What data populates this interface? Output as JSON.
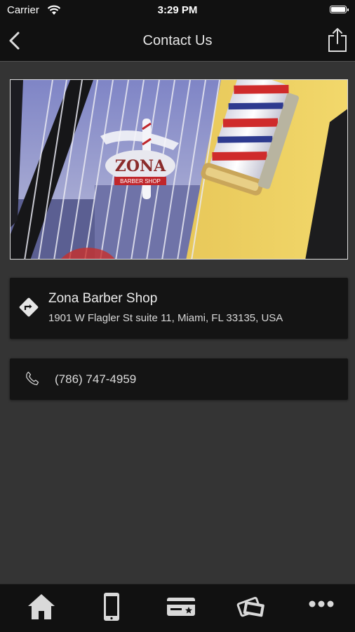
{
  "status_bar": {
    "carrier": "Carrier",
    "time": "3:29 PM"
  },
  "nav": {
    "title": "Contact Us",
    "back_icon": "chevron-left-icon",
    "share_icon": "share-icon"
  },
  "hero_image": {
    "sign_text": "ZONA",
    "sign_subtext": "BARBER SHOP"
  },
  "address_card": {
    "name": "Zona Barber Shop",
    "address": "1901 W Flagler St suite 11, Miami, FL 33135, USA",
    "icon": "directions-icon"
  },
  "phone_card": {
    "number": "(786) 747-4959",
    "icon": "phone-icon"
  },
  "tab_bar": {
    "tabs": [
      {
        "icon": "home-icon"
      },
      {
        "icon": "mobile-phone-icon"
      },
      {
        "icon": "card-icon"
      },
      {
        "icon": "tickets-icon"
      },
      {
        "icon": "more-icon"
      }
    ]
  },
  "colors": {
    "background": "#343434",
    "bar": "#111111",
    "card": "#141414"
  }
}
